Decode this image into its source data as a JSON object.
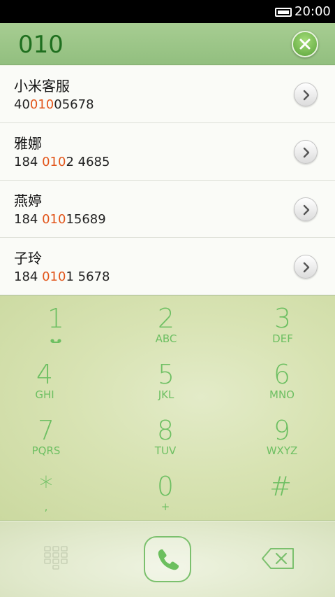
{
  "status_bar": {
    "time": "20:00",
    "battery_icon": "battery-icon"
  },
  "search": {
    "query": "010",
    "clear_icon": "close-icon"
  },
  "results": [
    {
      "name": "小米客服",
      "number_pre": "40",
      "number_match": "010",
      "number_post": "05678"
    },
    {
      "name": "雅娜",
      "number_pre": "184 ",
      "number_match": "010",
      "number_post": "2 4685"
    },
    {
      "name": "燕婷",
      "number_pre": "184 ",
      "number_match": "010",
      "number_post": "15689"
    },
    {
      "name": "子玲",
      "number_pre": "184 ",
      "number_match": "010",
      "number_post": "1 5678"
    }
  ],
  "dialpad": {
    "keys": [
      {
        "digit": "1",
        "letters": ""
      },
      {
        "digit": "2",
        "letters": "ABC"
      },
      {
        "digit": "3",
        "letters": "DEF"
      },
      {
        "digit": "4",
        "letters": "GHI"
      },
      {
        "digit": "5",
        "letters": "JKL"
      },
      {
        "digit": "6",
        "letters": "MNO"
      },
      {
        "digit": "7",
        "letters": "PQRS"
      },
      {
        "digit": "8",
        "letters": "TUV"
      },
      {
        "digit": "9",
        "letters": "WXYZ"
      },
      {
        "digit": "*",
        "letters": ","
      },
      {
        "digit": "0",
        "letters": "+"
      },
      {
        "digit": "#",
        "letters": ""
      }
    ]
  },
  "bottom_bar": {
    "keypad_icon": "keypad-icon",
    "call_icon": "phone-icon",
    "backspace_icon": "backspace-icon"
  },
  "colors": {
    "accent_green": "#6dbf62",
    "match_highlight": "#e2561b",
    "header_green": "#9cc789"
  }
}
